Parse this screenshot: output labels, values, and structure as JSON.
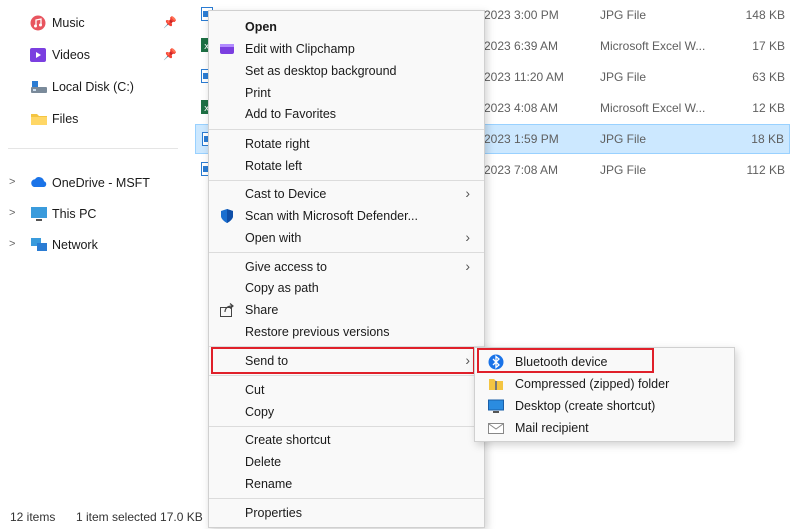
{
  "sidebar": {
    "quick_access": [
      {
        "label": "Music",
        "icon": "music-icon"
      },
      {
        "label": "Videos",
        "icon": "videos-icon"
      },
      {
        "label": "Local Disk (C:)",
        "icon": "disk-icon"
      },
      {
        "label": "Files",
        "icon": "folder-icon"
      }
    ],
    "roots": [
      {
        "label": "OneDrive - MSFT",
        "icon": "onedrive-icon"
      },
      {
        "label": "This PC",
        "icon": "this-pc-icon"
      },
      {
        "label": "Network",
        "icon": "network-icon"
      }
    ]
  },
  "files": [
    {
      "date": "2023 3:00 PM",
      "type": "JPG File",
      "size": "148 KB",
      "kind": "jpg"
    },
    {
      "date": "2023 6:39 AM",
      "type": "Microsoft Excel W...",
      "size": "17 KB",
      "kind": "xls"
    },
    {
      "date": "2023 11:20 AM",
      "type": "JPG File",
      "size": "63 KB",
      "kind": "jpg"
    },
    {
      "date": "2023 4:08 AM",
      "type": "Microsoft Excel W...",
      "size": "12 KB",
      "kind": "xls"
    },
    {
      "date": "2023 1:59 PM",
      "type": "JPG File",
      "size": "18 KB",
      "kind": "jpg",
      "selected": true
    },
    {
      "date": "2023 7:08 AM",
      "type": "JPG File",
      "size": "112 KB",
      "kind": "jpg"
    }
  ],
  "status": {
    "items": "12 items",
    "selection": "1 item selected  17.0 KB"
  },
  "context_menu": {
    "open": "Open",
    "edit_clipchamp": "Edit with Clipchamp",
    "set_background": "Set as desktop background",
    "print": "Print",
    "add_favorites": "Add to Favorites",
    "rotate_right": "Rotate right",
    "rotate_left": "Rotate left",
    "cast": "Cast to Device",
    "scan": "Scan with Microsoft Defender...",
    "open_with": "Open with",
    "give_access": "Give access to",
    "copy_path": "Copy as path",
    "share": "Share",
    "restore": "Restore previous versions",
    "send_to": "Send to",
    "cut": "Cut",
    "copy": "Copy",
    "create_shortcut": "Create shortcut",
    "delete": "Delete",
    "rename": "Rename",
    "properties": "Properties"
  },
  "send_to_menu": {
    "bluetooth": "Bluetooth device",
    "compressed": "Compressed (zipped) folder",
    "desktop": "Desktop (create shortcut)",
    "mail": "Mail recipient"
  },
  "colors": {
    "selection": "#cce8ff",
    "highlight_border": "#e0202a",
    "accent": "#0078d4"
  }
}
